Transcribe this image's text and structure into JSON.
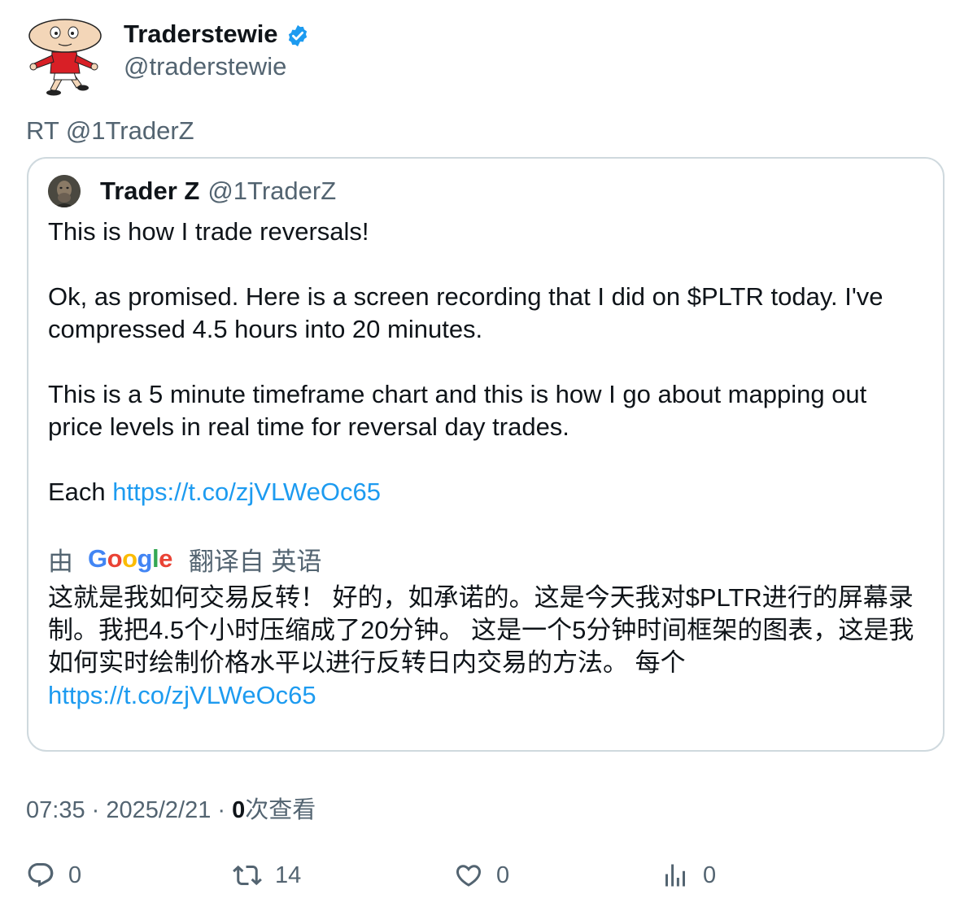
{
  "author": {
    "display_name": "Traderstewie",
    "handle": "@traderstewie",
    "verified_icon": "verified-badge-icon",
    "avatar_icon": "stewie-cartoon-avatar"
  },
  "retweet_line": "RT @1TraderZ",
  "quoted": {
    "display_name": "Trader Z",
    "handle": "@1TraderZ",
    "avatar_icon": "trader-z-avatar",
    "paragraph1": "This is how I trade reversals!",
    "paragraph2": "Ok, as promised. Here is a screen recording that I did on $PLTR today. I've compressed 4.5 hours into 20 minutes.",
    "paragraph3": "This is a 5 minute timeframe chart and this is how I go about mapping out price levels in real time for reversal day trades.",
    "paragraph4_prefix": "Each ",
    "link": "https://t.co/zjVLWeOc65"
  },
  "translation": {
    "by": "由",
    "google_logo": "Google",
    "translated_from": "翻译自 英语",
    "text": "这就是我如何交易反转！ 好的，如承诺的。这是今天我对$PLTR进行的屏幕录制。我把4.5个小时压缩成了20分钟。 这是一个5分钟时间框架的图表，这是我如何实时绘制价格水平以进行反转日内交易的方法。 每个",
    "link": "https://t.co/zjVLWeOc65"
  },
  "meta": {
    "time": "07:35",
    "separator": " · ",
    "date": "2025/2/21",
    "views_count": "0",
    "views_label": "次查看"
  },
  "actions": {
    "reply_count": "0",
    "retweet_count": "14",
    "like_count": "0",
    "views_count": "0"
  },
  "colors": {
    "link": "#1d9bf0",
    "secondary_text": "#536471",
    "border": "#cfd9de",
    "verified": "#1d9bf0"
  }
}
